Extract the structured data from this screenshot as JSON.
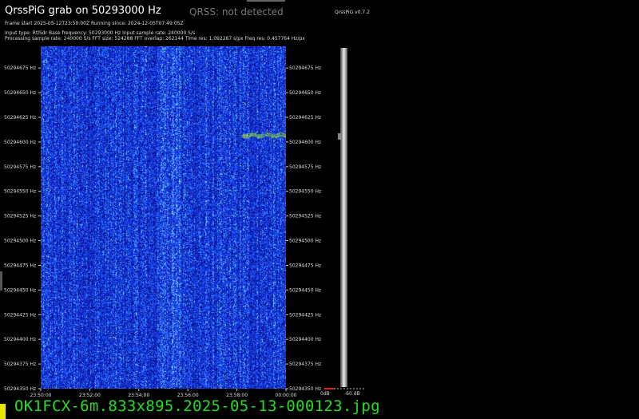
{
  "header": {
    "title": "QrssPiG grab on 50293000 Hz",
    "qrss_status": "QRSS: not detected",
    "version": "QrssPiG v0.7.2",
    "info_line1": "Frame start 2025-05-12T23:50:00Z Running since: 2024-12-05T07:49:05Z",
    "info_line2": "Input type: RtlSdr Base frequency: 50293000 Hz Input sample rate: 240000 S/s",
    "info_line3": "Processing sample rate: 240000 S/s FFT size: 524288 FFT overlap: 262144 Time res: 1.092267 s/px Freq res: 0.457764 Hz/px"
  },
  "freq_axis": {
    "labels": [
      "50294675 Hz",
      "50294650 Hz",
      "50294625 Hz",
      "50294600 Hz",
      "50294575 Hz",
      "50294550 Hz",
      "50294525 Hz",
      "50294500 Hz",
      "50294475 Hz",
      "50294450 Hz",
      "50294425 Hz",
      "50294400 Hz",
      "50294375 Hz",
      "50294350 Hz"
    ],
    "range_hz": [
      50294350,
      50294697
    ]
  },
  "time_axis": {
    "labels": [
      "23:50:00",
      "23:52:00",
      "23:54:00",
      "23:56:00",
      "23:58:00",
      "00:00:00"
    ]
  },
  "scale": {
    "left_label": "0dB",
    "right_label": "-60 dB"
  },
  "signal": {
    "freq_hz": 50294607,
    "start_fraction": 0.82,
    "end_fraction": 1.0
  },
  "colors": {
    "background": "#000000",
    "waterfall_base": "#1a2fd8",
    "signal": "#c8e838",
    "filename": "#22dd22"
  },
  "footer": {
    "filename": "OK1FCX-6m.833x895.2025-05-13-000123.jpg"
  }
}
